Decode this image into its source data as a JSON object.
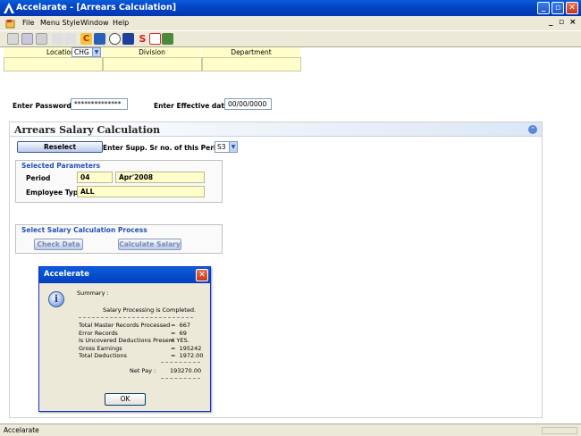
{
  "window": {
    "title": "Accelarate - [Arrears Calculation]"
  },
  "menu": {
    "file": "File",
    "menu_style": "Menu Style",
    "window": "Window",
    "help": "Help"
  },
  "header": {
    "location_label": "Location",
    "location_value": "CHG",
    "division_label": "Division",
    "department_label": "Department"
  },
  "credentials": {
    "password_label": "Enter Password:",
    "password_value": "**************",
    "effective_date_label": "Enter Effective date:",
    "effective_date_value": "00/00/0000"
  },
  "panel": {
    "title": "Arrears Salary Calculation",
    "reselect_label": "Reselect",
    "supp_label": "Enter Supp. Sr no. of this Period:",
    "supp_value": "S3"
  },
  "selected_params": {
    "title": "Selected Parameters",
    "period_label": "Period",
    "period_value": "04",
    "period_month": "Apr'2008",
    "emp_type_label": "Employee Type:",
    "emp_type_value": "ALL"
  },
  "process": {
    "title": "Select Salary Calculation Process",
    "check_data_label": "Check Data",
    "calc_salary_label": "Calculate Salary"
  },
  "dialog": {
    "title": "Accelerate",
    "summary": "Summary :",
    "completed": "Salary Processing is Completed.",
    "rows": [
      {
        "label": "Total Master Records Processed",
        "value": "=  667"
      },
      {
        "label": "Error Records",
        "value": "=  69"
      },
      {
        "label": "Is Uncovered Deductions Present",
        "value": "= YES."
      },
      {
        "label": "Gross Earnings",
        "value": "=  195242"
      },
      {
        "label": "Total Deductions",
        "value": "=  1972.00"
      }
    ],
    "net_pay_label": "Net Pay :",
    "net_pay_value": "193270.00",
    "ok_label": "OK"
  },
  "status": {
    "text": "Accelarate"
  }
}
